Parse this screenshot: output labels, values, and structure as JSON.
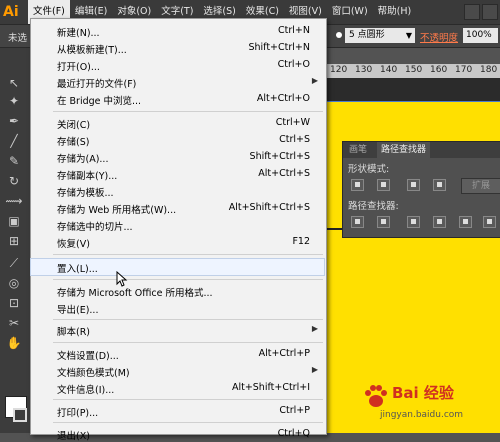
{
  "app": {
    "logo": "Ai"
  },
  "menubar": {
    "items": [
      "文件(F)",
      "编辑(E)",
      "对象(O)",
      "文字(T)",
      "选择(S)",
      "效果(C)",
      "视图(V)",
      "窗口(W)",
      "帮助(H)"
    ],
    "active_index": 0
  },
  "control_bar": {
    "left_text": "未选",
    "brush_size": "5 点圆形",
    "opacity_label": "不透明度",
    "opacity_value": "100%"
  },
  "ruler": {
    "labels": [
      "120",
      "130",
      "140",
      "150",
      "160",
      "170",
      "180"
    ]
  },
  "pathfinder_panel": {
    "tabs": [
      "画笔",
      "路径查找器"
    ],
    "active_tab": 1,
    "shape_modes_label": "形状模式:",
    "pathfinders_label": "路径查找器:",
    "expand_label": "扩展"
  },
  "file_menu": {
    "items": [
      {
        "label": "新建(N)...",
        "shortcut": "Ctrl+N"
      },
      {
        "label": "从模板新建(T)...",
        "shortcut": "Shift+Ctrl+N"
      },
      {
        "label": "打开(O)...",
        "shortcut": "Ctrl+O"
      },
      {
        "label": "最近打开的文件(F)",
        "shortcut": "",
        "submenu": true
      },
      {
        "label": "在 Bridge 中浏览...",
        "shortcut": "Alt+Ctrl+O"
      },
      {
        "label": "关闭(C)",
        "shortcut": "Ctrl+W"
      },
      {
        "label": "存储(S)",
        "shortcut": "Ctrl+S"
      },
      {
        "label": "存储为(A)...",
        "shortcut": "Shift+Ctrl+S"
      },
      {
        "label": "存储副本(Y)...",
        "shortcut": "Alt+Ctrl+S"
      },
      {
        "label": "存储为模板...",
        "shortcut": ""
      },
      {
        "label": "存储为 Web 所用格式(W)...",
        "shortcut": "Alt+Shift+Ctrl+S"
      },
      {
        "label": "存储选中的切片...",
        "shortcut": ""
      },
      {
        "label": "恢复(V)",
        "shortcut": "F12"
      },
      {
        "label": "置入(L)...",
        "shortcut": "",
        "highlighted": true
      },
      {
        "label": "存储为 Microsoft Office 所用格式...",
        "shortcut": ""
      },
      {
        "label": "导出(E)...",
        "shortcut": ""
      },
      {
        "label": "脚本(R)",
        "shortcut": "",
        "submenu": true
      },
      {
        "label": "文档设置(D)...",
        "shortcut": "Alt+Ctrl+P"
      },
      {
        "label": "文档颜色模式(M)",
        "shortcut": "",
        "submenu": true
      },
      {
        "label": "文件信息(I)...",
        "shortcut": "Alt+Shift+Ctrl+I"
      },
      {
        "label": "打印(P)...",
        "shortcut": "Ctrl+P"
      },
      {
        "label": "退出(X)",
        "shortcut": "Ctrl+Q"
      }
    ],
    "submenu_arrow": "▶"
  },
  "watermark": {
    "brand": "Bai 经验",
    "url": "jingyan.baidu.com"
  }
}
